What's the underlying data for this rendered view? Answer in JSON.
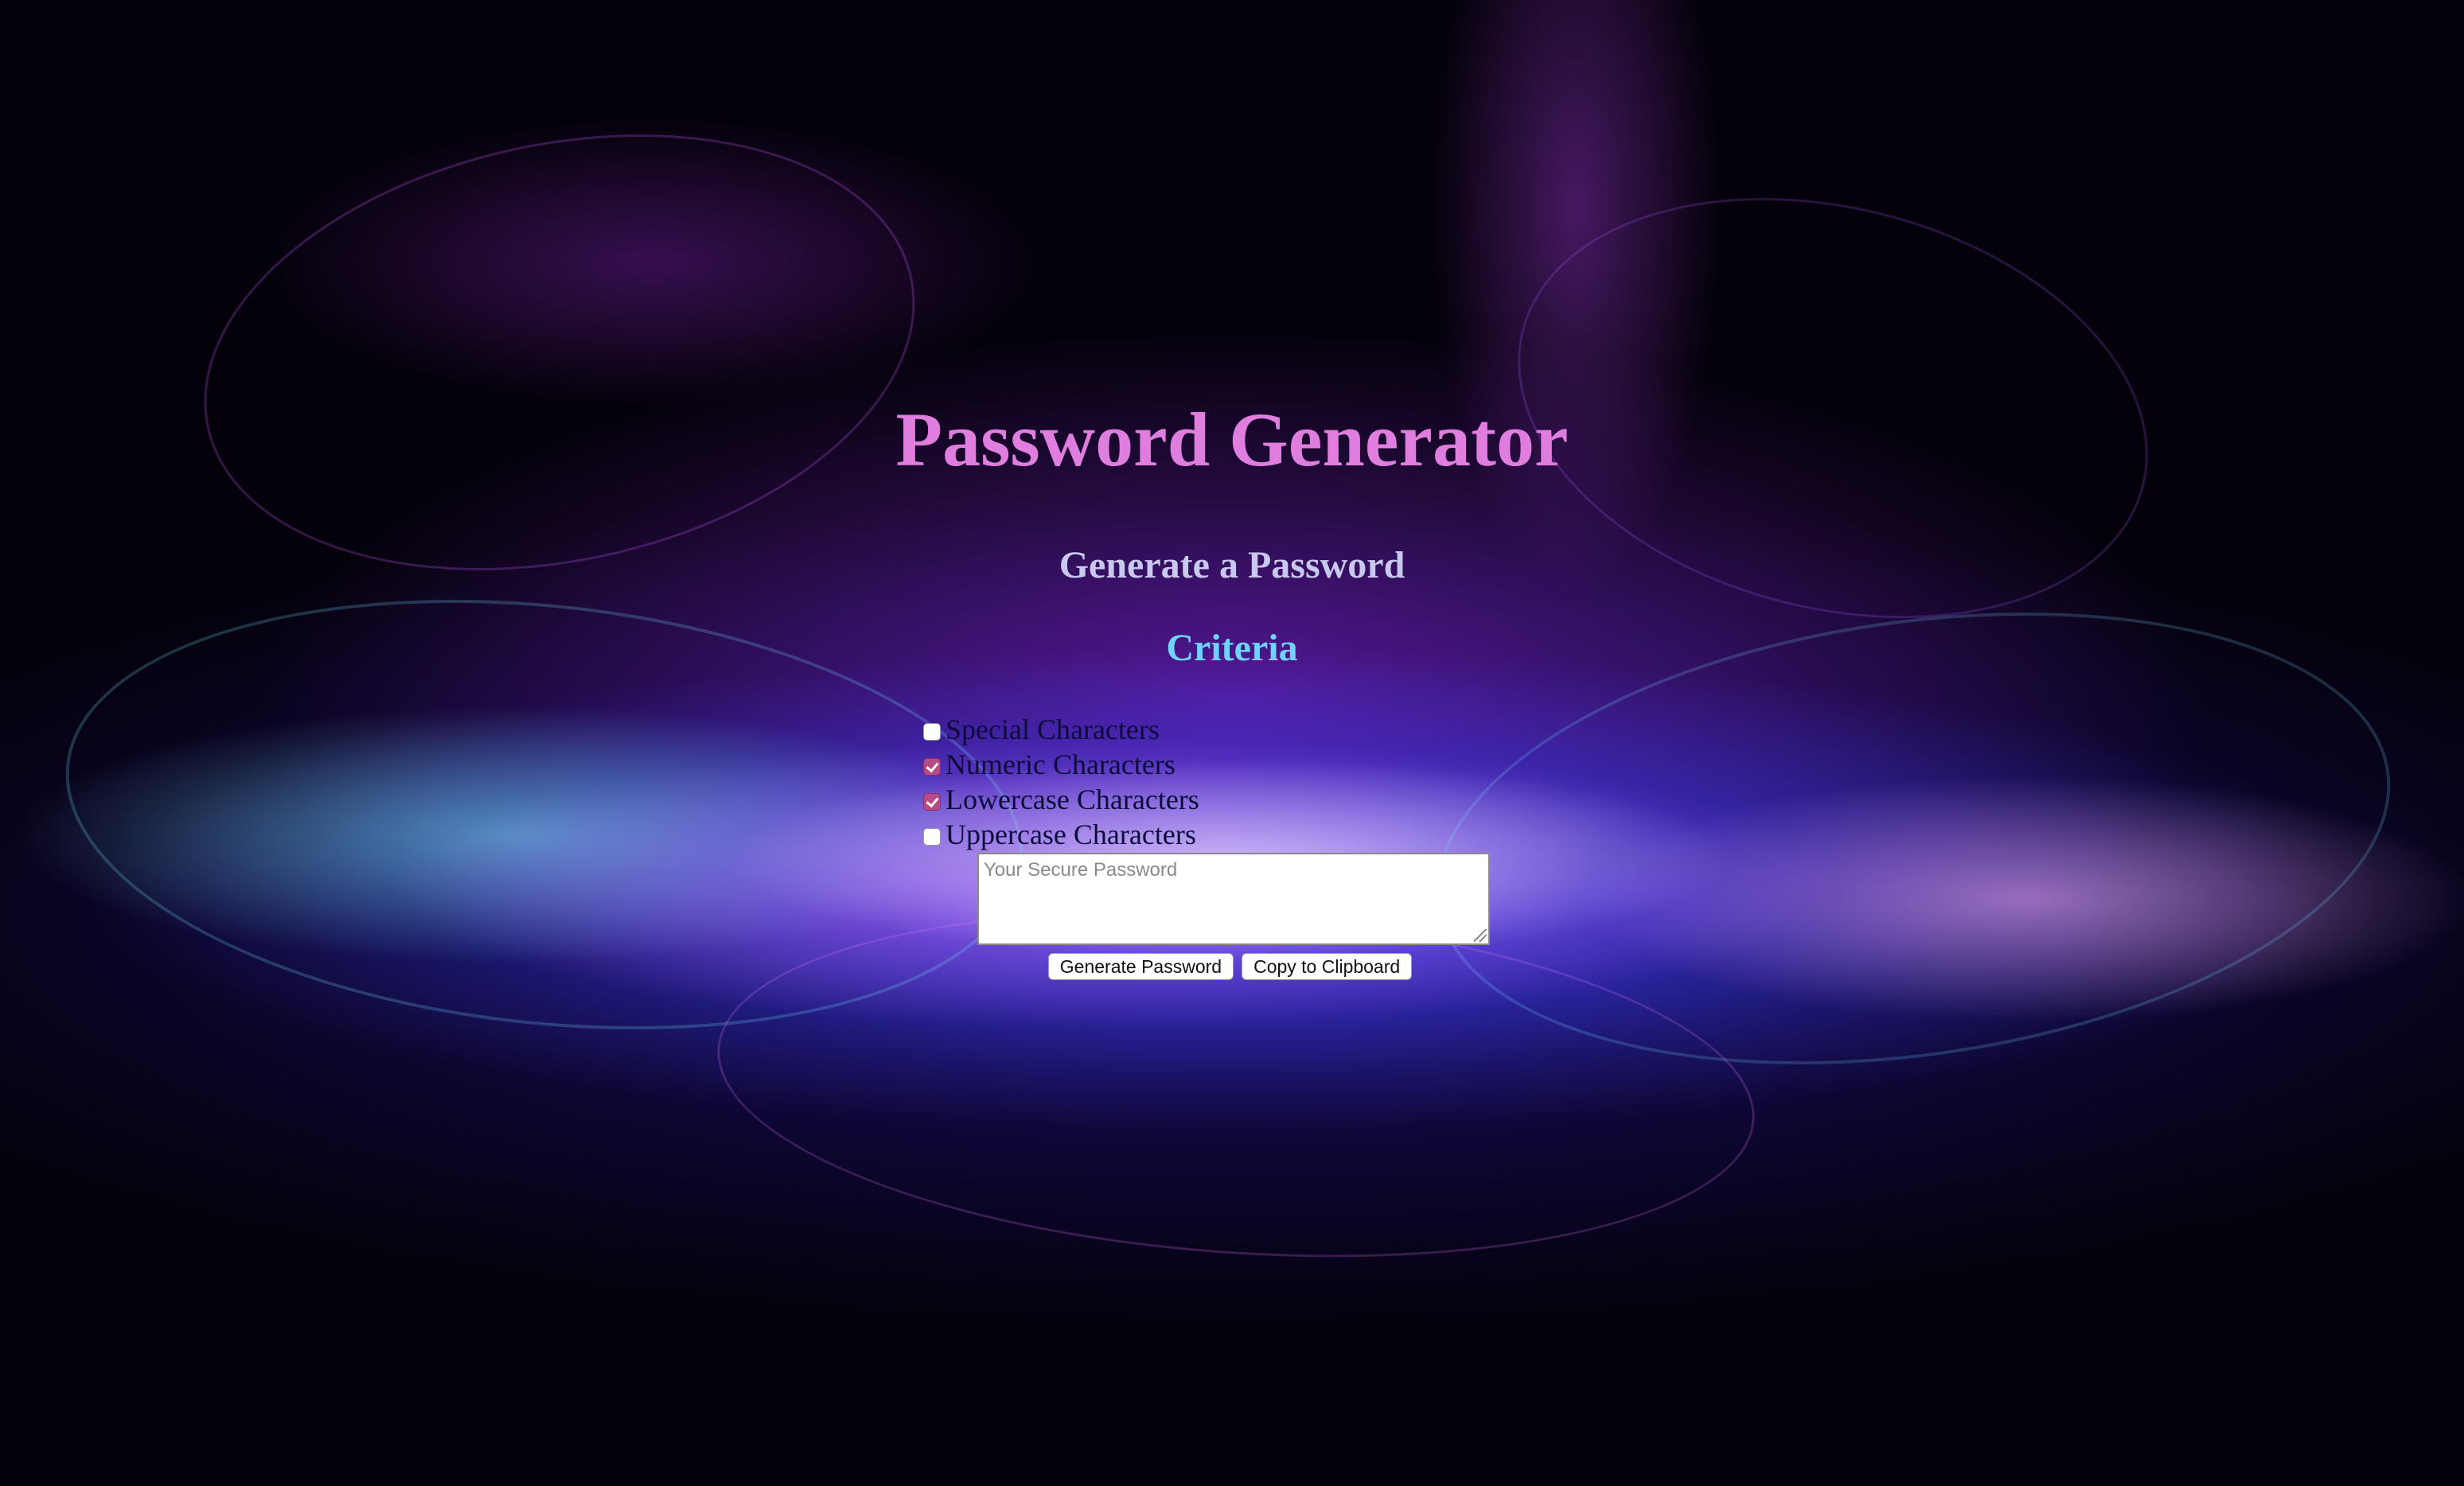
{
  "page": {
    "title": "Password Generator",
    "subtitle": "Generate a Password",
    "criteria_heading": "Criteria"
  },
  "options": [
    {
      "label": "Special Characters",
      "checked": false
    },
    {
      "label": "Numeric Characters",
      "checked": true
    },
    {
      "label": "Lowercase Characters",
      "checked": true
    },
    {
      "label": "Uppercase Characters",
      "checked": false
    }
  ],
  "password_box": {
    "placeholder": "Your Secure Password",
    "value": ""
  },
  "buttons": {
    "generate": "Generate Password",
    "copy": "Copy to Clipboard"
  },
  "colors": {
    "title": "#e07ee0",
    "subtitle": "#c8c8f0",
    "criteria": "#6fd2ff",
    "checked_box": "#b84a86"
  }
}
